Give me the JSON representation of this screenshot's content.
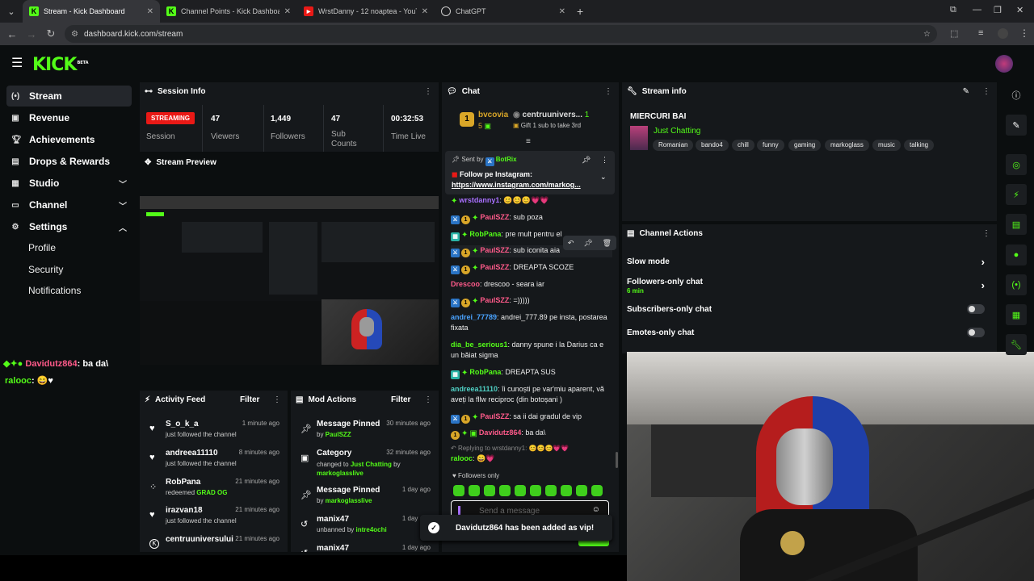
{
  "browser": {
    "tabs": [
      {
        "title": "Stream - Kick Dashboard",
        "icon": "kick-icon",
        "color": "#53fc18"
      },
      {
        "title": "Channel Points - Kick Dashboard",
        "icon": "kick-icon",
        "color": "#53fc18"
      },
      {
        "title": "WrstDanny - 12 noaptea - YouTube",
        "icon": "youtube-icon",
        "color": "#e91916"
      },
      {
        "title": "ChatGPT",
        "icon": "chatgpt-icon",
        "color": "#ffffff"
      }
    ],
    "url": "dashboard.kick.com/stream"
  },
  "header": {
    "logo": "KICK",
    "logo_beta": "BETA"
  },
  "sidebar": {
    "items": [
      {
        "label": "Stream",
        "icon": "broadcast-icon"
      },
      {
        "label": "Revenue",
        "icon": "wallet-icon"
      },
      {
        "label": "Achievements",
        "icon": "trophy-icon"
      },
      {
        "label": "Drops & Rewards",
        "icon": "gift-icon"
      },
      {
        "label": "Studio",
        "icon": "studio-icon"
      },
      {
        "label": "Channel",
        "icon": "channel-icon"
      },
      {
        "label": "Settings",
        "icon": "gear-icon"
      }
    ],
    "settings_sub": [
      "Profile",
      "Security",
      "Notifications"
    ]
  },
  "overlay_chat": [
    {
      "user": "Davidutz864",
      "text": ": ba da\\"
    },
    {
      "user": "ralooc",
      "text": ": 😄♥"
    }
  ],
  "session": {
    "title": "Session Info",
    "status": "STREAMING",
    "status_label": "Session",
    "stats": [
      {
        "value": "47",
        "label": "Viewers"
      },
      {
        "value": "1,449",
        "label": "Followers"
      },
      {
        "value": "47",
        "label": "Sub Counts"
      },
      {
        "value": "00:32:53",
        "label": "Time Live"
      }
    ]
  },
  "preview": {
    "title": "Stream Preview"
  },
  "activity": {
    "title": "Activity Feed",
    "filter": "Filter",
    "rows": [
      {
        "name": "S_o_k_a",
        "time": "1 minute ago",
        "desc": "just followed the channel",
        "icon": "heart-icon"
      },
      {
        "name": "andreea11110",
        "time": "8 minutes ago",
        "desc": "just followed the channel",
        "icon": "heart-icon"
      },
      {
        "name": "RobPana",
        "time": "21 minutes ago",
        "desc": "redeemed",
        "highlight": "GRAD OG",
        "icon": "points-icon"
      },
      {
        "name": "irazvan18",
        "time": "21 minutes ago",
        "desc": "just followed the channel",
        "icon": "heart-icon"
      },
      {
        "name": "centruuniversului",
        "time": "21 minutes ago",
        "desc": "",
        "icon": "kick-icon"
      }
    ]
  },
  "mod": {
    "title": "Mod Actions",
    "filter": "Filter",
    "rows": [
      {
        "name": "Message Pinned",
        "time": "30 minutes ago",
        "pre": "by ",
        "who": "PaulSZZ",
        "icon": "pin-icon"
      },
      {
        "name": "Category",
        "time": "32 minutes ago",
        "pre": "changed to ",
        "who": "Just Chatting",
        "post": " by",
        "who2": "markoglasslive",
        "icon": "category-icon"
      },
      {
        "name": "Message Pinned",
        "time": "1 day ago",
        "pre": "by ",
        "who": "markoglasslive",
        "icon": "pin-icon"
      },
      {
        "name": "manix47",
        "time": "1 day ago",
        "pre": "unbanned by ",
        "who": "intre4ochi",
        "icon": "undo-icon"
      },
      {
        "name": "manix47",
        "time": "1 day ago",
        "pre": "",
        "who": "",
        "icon": "undo-icon"
      }
    ]
  },
  "chat": {
    "title": "Chat",
    "top_gifter": {
      "name": "bvcovia",
      "count": "5",
      "rank": "1"
    },
    "gift": {
      "name": "centruunivers...",
      "count": "1",
      "text": "Gift 1 sub to take 3rd"
    },
    "pinned": {
      "sent_by": "Sent by",
      "bot": "BotRix",
      "text": "Follow pe Instagram:",
      "link": "https://www.instagram.com/markog..."
    },
    "messages": [
      {
        "user": "wrstdanny1",
        "color": "#a970ff",
        "text": ": 😊😊😊💗💗"
      },
      {
        "user": "PaulSZZ",
        "color": "#ff5a8a",
        "text": ": sub poza"
      },
      {
        "user": "RobPana",
        "color": "#53fc18",
        "text": ": pre mult pentru el"
      },
      {
        "user": "PaulSZZ",
        "color": "#ff5a8a",
        "text": ": sub iconita aia"
      },
      {
        "user": "PaulSZZ",
        "color": "#ff5a8a",
        "text": ": DREAPTA SCOZE"
      },
      {
        "user": "Drescoo",
        "color": "#ff5a8a",
        "text": ": drescoo - seara iar"
      },
      {
        "user": "PaulSZZ",
        "color": "#ff5a8a",
        "text": ": =)))))"
      },
      {
        "user": "andrei_77789",
        "color": "#4aa3ff",
        "text": ": andrei_777.89 pe insta, postarea fixata"
      },
      {
        "user": "dia_be_serious1",
        "color": "#53fc18",
        "text": ": danny spune i la Darius ca e un băiat sigma"
      },
      {
        "user": "RobPana",
        "color": "#53fc18",
        "text": ": DREAPTA SUS"
      },
      {
        "user": "andreea11110",
        "color": "#4fd1c5",
        "text": ": îi cunoști pe var'miu aparent, vă aveți la fllw reciproc (din botoșani )"
      },
      {
        "user": "PaulSZZ",
        "color": "#ff5a8a",
        "text": ": sa ii dai gradul de vip"
      },
      {
        "user": "Davidutz864",
        "color": "#ff5a8a",
        "text": ": ba da\\"
      }
    ],
    "reply_to": "Replying to wrstdanny1: 😊😊😊💗💗",
    "reply": {
      "user": "ralooc",
      "text": ": 😄💗"
    },
    "followers_only": "Followers only",
    "placeholder": "Send a message",
    "toast": "Davidutz864 has been added as vip!"
  },
  "stream_info": {
    "title": "Stream info",
    "stream_title": "MIERCURI BAI",
    "category": "Just Chatting",
    "tags": [
      "Romanian",
      "bando4",
      "chill",
      "funny",
      "gaming",
      "markoglass",
      "music",
      "talking"
    ]
  },
  "channel_actions": {
    "title": "Channel Actions",
    "rows": [
      {
        "label": "Slow mode",
        "control": "arrow"
      },
      {
        "label": "Followers-only chat",
        "sub": "6 min",
        "control": "arrow"
      },
      {
        "label": "Subscribers-only chat",
        "control": "toggle"
      },
      {
        "label": "Emotes-only chat",
        "control": "toggle"
      }
    ]
  },
  "rightbar": [
    "info-icon",
    "edit-icon",
    "camera-icon",
    "lightning-icon",
    "clipboard-icon",
    "chat-bubble-icon",
    "broadcast-icon",
    "calendar-icon",
    "wrench-icon"
  ]
}
